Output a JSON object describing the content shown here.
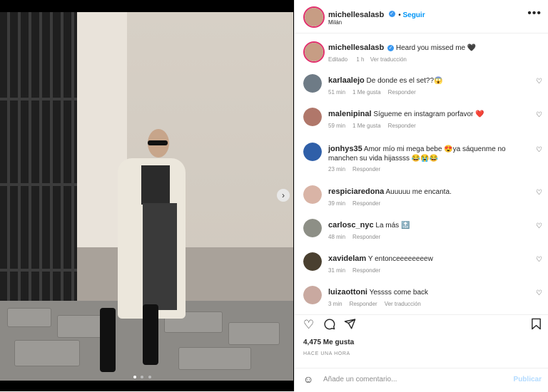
{
  "post": {
    "username": "michellesalasb",
    "follow_label": "Seguir",
    "location": "Milán",
    "caption": "Heard you missed me 🖤",
    "caption_meta": {
      "edited": "Editado",
      "time": "1 h",
      "translate": "Ver traducción"
    },
    "like_count": "4,475 Me gusta",
    "posted_ago": "HACE UNA HORA",
    "comment_placeholder": "Añade un comentario...",
    "publish_label": "Publicar",
    "carousel": {
      "slides": 3,
      "active": 1
    }
  },
  "comments": [
    {
      "username": "karlaalejo",
      "text": "De donde es el set??😱",
      "time": "51 min",
      "likes": "1 Me gusta",
      "reply": "Responder",
      "avatar_color": "#6e7b86"
    },
    {
      "username": "malenipinal",
      "text": "Sígueme en instagram porfavor ❤️",
      "time": "59 min",
      "likes": "1 Me gusta",
      "reply": "Responder",
      "avatar_color": "#b0776a"
    },
    {
      "username": "jonhys35",
      "text": "Amor mío mi mega bebe 😍ya sáquenme no manchen su vida hijassss 😂😭😂",
      "time": "23 min",
      "likes": "",
      "reply": "Responder",
      "avatar_color": "#2f5fa8"
    },
    {
      "username": "respiciaredona",
      "text": "Auuuuu me encanta.",
      "time": "39 min",
      "likes": "",
      "reply": "Responder",
      "avatar_color": "#d9b4a6"
    },
    {
      "username": "carlosc_nyc",
      "text": "La más 🔝",
      "time": "48 min",
      "likes": "",
      "reply": "Responder",
      "avatar_color": "#8d8f86"
    },
    {
      "username": "xavidelam",
      "text": "Y entonceeeeeeeew",
      "time": "31 min",
      "likes": "",
      "reply": "Responder",
      "avatar_color": "#4a4030"
    },
    {
      "username": "luizaottoni",
      "text": "Yessss come back",
      "time": "3 min",
      "likes": "",
      "reply": "Responder",
      "translate": "Ver traducción",
      "avatar_color": "#c9a9a0"
    }
  ],
  "icons": {
    "more": "more-options-icon",
    "heart": "heart-icon",
    "comment": "comment-icon",
    "share": "share-icon",
    "save": "bookmark-icon",
    "emoji": "emoji-icon",
    "verified": "verified-badge-icon",
    "next": "chevron-right-icon"
  },
  "colors": {
    "accent": "#0095f6",
    "verified": "#3897f0",
    "muted": "#8e8e8e"
  }
}
